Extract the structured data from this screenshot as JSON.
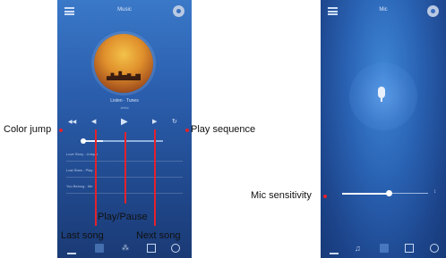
{
  "left_screen": {
    "title": "Music",
    "song_title": "Listen · Tunes",
    "song_subtitle": "Artist",
    "controls": [
      "color-jump",
      "last-song",
      "play-pause",
      "next-song",
      "play-sequence"
    ],
    "progress": 0.25,
    "playlist": [
      "Love Story - Unique",
      "Lost Stars - Play",
      "You Belong - Me"
    ],
    "tabs": [
      "music",
      "library",
      "effects",
      "mode",
      "timer"
    ],
    "active_tab": 1
  },
  "right_screen": {
    "title": "Mic",
    "mic_sensitivity": 0.55,
    "tabs": [
      "equalizer",
      "music",
      "mic",
      "mode",
      "timer"
    ],
    "active_tab": 2
  },
  "annotations": {
    "color_jump": "Color jump",
    "play_sequence": "Play sequence",
    "play_pause": "Play/Pause",
    "last_song": "Last  song",
    "next_song": "Next song",
    "mic_sensitivity": "Mic sensitivity"
  },
  "colors": {
    "annotation_red": "#e4212b",
    "screen_blue": "#2b5fae"
  }
}
